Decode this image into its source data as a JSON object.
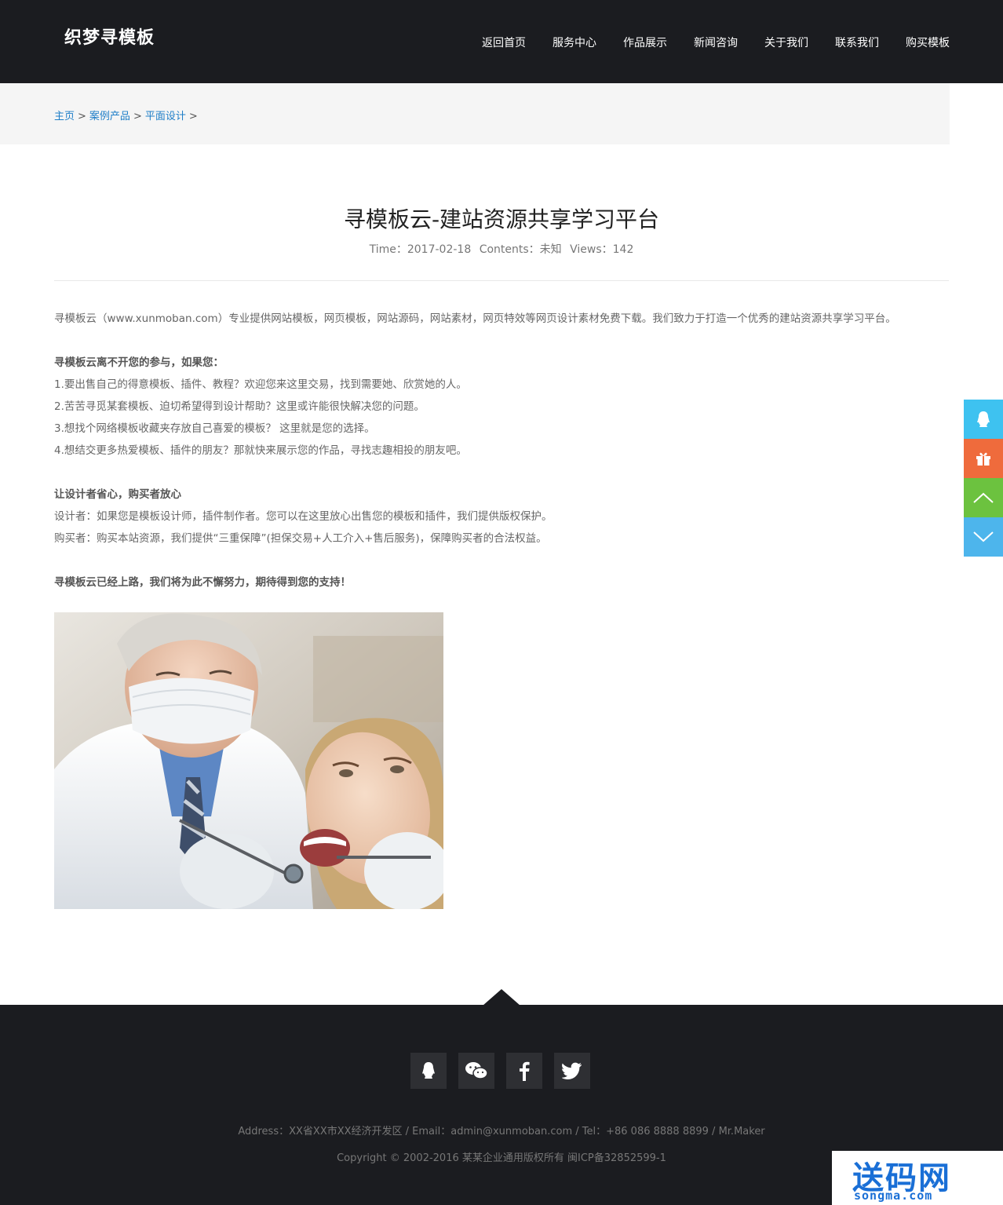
{
  "header": {
    "logo": "织梦寻模板",
    "nav": [
      "返回首页",
      "服务中心",
      "作品展示",
      "新闻咨询",
      "关于我们",
      "联系我们",
      "购买模板"
    ]
  },
  "breadcrumb": {
    "items": [
      "主页",
      "案例产品",
      "平面设计"
    ],
    "separator": ">"
  },
  "article": {
    "title": "寻模板云-建站资源共享学习平台",
    "meta": {
      "time": "Time：2017-02-18",
      "contents": "Contents：未知",
      "views": "Views：142"
    },
    "p1": "寻模板云（www.xunmoban.com）专业提供网站模板，网页模板，网站源码，网站素材，网页特效等网页设计素材免费下载。我们致力于打造一个优秀的建站资源共享学习平台。",
    "h1": "寻模板云离不开您的参与，如果您：",
    "l1": "1.要出售自己的得意模板、插件、教程？欢迎您来这里交易，找到需要她、欣赏她的人。",
    "l2": "2.苦苦寻觅某套模板、迫切希望得到设计帮助？这里或许能很快解决您的问题。",
    "l3": "3.想找个网络模板收藏夹存放自己喜爱的模板？ 这里就是您的选择。",
    "l4": "4.想结交更多热爱模板、插件的朋友？那就快来展示您的作品，寻找志趣相投的朋友吧。",
    "h2": "让设计者省心，购买者放心",
    "d1": "设计者：如果您是模板设计师，插件制作者。您可以在这里放心出售您的模板和插件，我们提供版权保护。",
    "d2": "购买者：购买本站资源，我们提供“三重保障”(担保交易+人工介入+售后服务)，保障购买者的合法权益。",
    "h3": "寻模板云已经上路，我们将为此不懈努力，期待得到您的支持！"
  },
  "footer": {
    "social_icons": [
      "qq-icon",
      "wechat-icon",
      "facebook-icon",
      "twitter-icon"
    ],
    "info": "Address：XX省XX市XX经济开发区 / Email：admin@xunmoban.com / Tel：+86 086 8888 8899 / Mr.Maker",
    "copyright": "Copyright © 2002-2016 某某企业通用版权所有  闽ICP备32852599-1"
  },
  "floatbar": {
    "buttons": [
      {
        "icon": "qq-icon",
        "color": "#3ec2f0"
      },
      {
        "icon": "gift-icon",
        "color": "#ef6b3c"
      },
      {
        "icon": "chevron-up-icon",
        "color": "#6cc23f"
      },
      {
        "icon": "chevron-down-icon",
        "color": "#4db5ec"
      }
    ]
  },
  "watermark": {
    "cn": "送码网",
    "en": "songma.com"
  },
  "colors": {
    "header_bg": "#1b1c20",
    "link_blue": "#1e7ec8",
    "breadcrumb_bg": "#f5f5f5"
  }
}
